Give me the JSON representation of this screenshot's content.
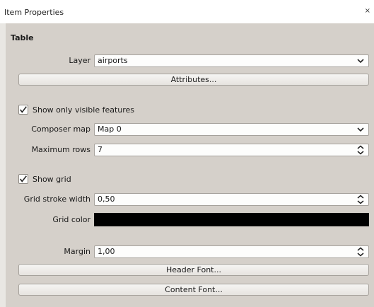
{
  "dock": {
    "title": "Item Properties",
    "close_glyph": "×"
  },
  "table": {
    "section_title": "Table",
    "layer": {
      "label": "Layer",
      "value": "airports"
    },
    "attributes_button": "Attributes...",
    "show_only_visible": {
      "label": "Show only visible features",
      "checked": true
    },
    "composer_map": {
      "label": "Composer map",
      "value": "Map 0"
    },
    "max_rows": {
      "label": "Maximum rows",
      "value": "7"
    },
    "show_grid": {
      "label": "Show grid",
      "checked": true
    },
    "grid_stroke_width": {
      "label": "Grid stroke width",
      "value": "0,50"
    },
    "grid_color": {
      "label": "Grid color",
      "color": "#000000"
    },
    "margin": {
      "label": "Margin",
      "value": "1,00"
    },
    "header_font_button": "Header Font...",
    "content_font_button": "Content Font..."
  }
}
